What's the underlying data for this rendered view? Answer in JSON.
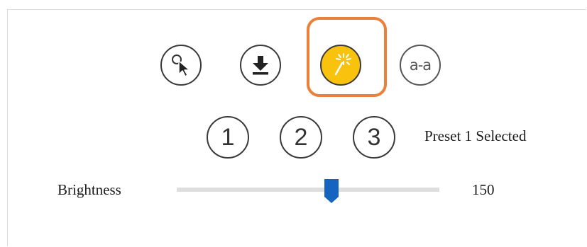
{
  "toolbar": {
    "tools": [
      {
        "name": "select-tool",
        "icon": "cursor-click-icon",
        "active": false
      },
      {
        "name": "download-tool",
        "icon": "download-arrow-icon",
        "active": false
      },
      {
        "name": "magic-wand-tool",
        "icon": "magic-wand-icon",
        "active": true
      },
      {
        "name": "text-compare-tool",
        "icon": "a-to-a-icon",
        "label": "a-a",
        "active": false
      }
    ],
    "active_color": "#f8c20d",
    "highlight_color": "#e9813a"
  },
  "presets": {
    "buttons": [
      "1",
      "2",
      "3"
    ],
    "status": "Preset 1 Selected"
  },
  "brightness": {
    "label": "Brightness",
    "value": "150",
    "min": 0,
    "max": 255,
    "thumb_color": "#1565c0"
  }
}
